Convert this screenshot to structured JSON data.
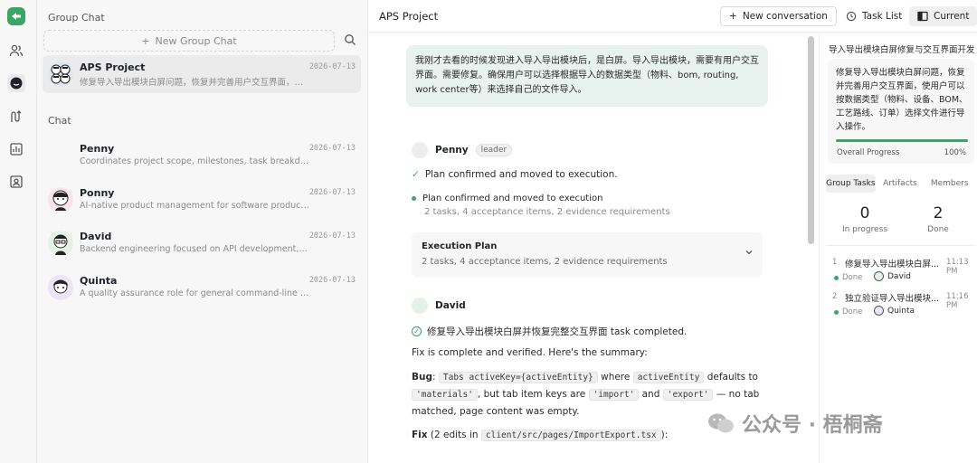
{
  "rail": {
    "icons": [
      "app-logo-icon",
      "users-icon",
      "chat-bubble-icon",
      "route-icon",
      "chart-icon",
      "contacts-icon"
    ]
  },
  "sidebar": {
    "group_title": "Group Chat",
    "new_group_label": "New Group Chat",
    "chat_title": "Chat",
    "groups": [
      {
        "name": "APS Project",
        "date": "2026-07-13",
        "desc": "修复导入导出模块白屏问题，恢复并完善用户交互界面，使用户可以按数据..."
      }
    ],
    "chats": [
      {
        "name": "Penny",
        "date": "2026-07-13",
        "desc": "Coordinates project scope, milestones, task breakdown, st..."
      },
      {
        "name": "Ponny",
        "date": "2026-07-13",
        "desc": "AI-native product management for software products, foc..."
      },
      {
        "name": "David",
        "date": "2026-07-13",
        "desc": "Backend engineering focused on API development, data m..."
      },
      {
        "name": "Quinta",
        "date": "2026-07-13",
        "desc": "A quality assurance role for general command-line tools a..."
      }
    ]
  },
  "header": {
    "title": "APS Project",
    "new_conversation": "New conversation",
    "task_list": "Task List",
    "current": "Current"
  },
  "chat": {
    "user_message": "我刚才去看的时候发现进入导入导出模块后，是白屏。导入导出模块，需要有用户交互界面。需要修复。确保用户可以选择根据导入的数据类型（物料、bom, routing, work center等）来选择自己的文件导入。",
    "penny": {
      "name": "Penny",
      "role": "leader",
      "confirmed": "Plan confirmed and moved to execution.",
      "bullet_title": "Plan confirmed and moved to execution",
      "bullet_sub": "2 tasks, 4 acceptance items, 2 evidence requirements",
      "plan_title": "Execution Plan",
      "plan_sub": "2 tasks, 4 acceptance items, 2 evidence requirements"
    },
    "david": {
      "name": "David",
      "completed": "修复导入导出模块白屏并恢复完整交互界面 task completed.",
      "summary": "Fix is complete and verified. Here's the summary:",
      "bug_label": "Bug",
      "bug_code1": "Tabs activeKey={activeEntity}",
      "bug_t1": "where",
      "bug_code2": "activeEntity",
      "bug_t2": "defaults to",
      "bug_code3": "'materials'",
      "bug_t3": ", but tab item keys are",
      "bug_code4": "'import'",
      "bug_t4": "and",
      "bug_code5": "'export'",
      "bug_t5": "— no tab",
      "bug_t6": "matched, page content was empty.",
      "fix_label": "Fix",
      "fix_t1": "(2 edits in",
      "fix_code": "client/src/pages/ImportExport.tsx",
      "fix_t2": "):"
    }
  },
  "panel": {
    "title": "导入导出模块白屏修复与交互界面开发",
    "desc": "修复导入导出模块白屏问题，恢复并完善用户交互界面，使用户可以按数据类型（物料、设备、BOM、工艺路线、订单）选择文件进行导入操作。",
    "progress_label": "Overall Progress",
    "progress_value": "100%",
    "progress_fraction": 1.0,
    "tabs": [
      "Group Tasks",
      "Artifacts",
      "Members"
    ],
    "in_progress_count": "0",
    "in_progress_label": "In progress",
    "done_count": "2",
    "done_label": "Done",
    "tasks": [
      {
        "num": "1",
        "title": "修复导入导出模块白屏...",
        "time": "11:13 PM",
        "status": "Done",
        "assignee": "David"
      },
      {
        "num": "2",
        "title": "独立验证导入导出模块...",
        "time": "11:16 PM",
        "status": "Done",
        "assignee": "Quinta"
      }
    ]
  },
  "watermark": "公众号 · 梧桐斋",
  "colors": {
    "accent_green": "#3aa564",
    "user_bubble": "#e8f2ee"
  }
}
